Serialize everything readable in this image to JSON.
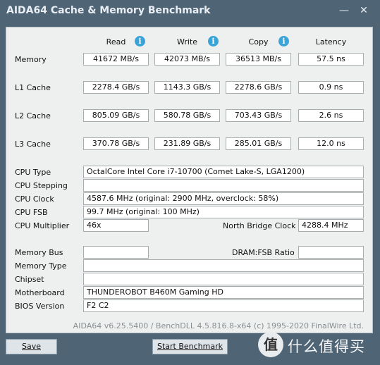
{
  "window": {
    "title": "AIDA64 Cache & Memory Benchmark"
  },
  "columns": {
    "read": "Read",
    "write": "Write",
    "copy": "Copy",
    "latency": "Latency"
  },
  "rows": [
    {
      "label": "Memory",
      "read": "41672 MB/s",
      "write": "42073 MB/s",
      "copy": "36513 MB/s",
      "latency": "57.5 ns"
    },
    {
      "label": "L1 Cache",
      "read": "2278.4 GB/s",
      "write": "1143.3 GB/s",
      "copy": "2278.6 GB/s",
      "latency": "0.9 ns"
    },
    {
      "label": "L2 Cache",
      "read": "805.09 GB/s",
      "write": "580.78 GB/s",
      "copy": "703.43 GB/s",
      "latency": "2.6 ns"
    },
    {
      "label": "L3 Cache",
      "read": "370.78 GB/s",
      "write": "231.89 GB/s",
      "copy": "285.01 GB/s",
      "latency": "12.0 ns"
    }
  ],
  "cpu": {
    "type_label": "CPU Type",
    "type": "OctalCore Intel Core i7-10700  (Comet Lake-S, LGA1200)",
    "stepping_label": "CPU Stepping",
    "stepping": "",
    "clock_label": "CPU Clock",
    "clock": "4587.6 MHz  (original: 2900 MHz, overclock: 58%)",
    "fsb_label": "CPU FSB",
    "fsb": "99.7 MHz  (original: 100 MHz)",
    "multiplier_label": "CPU Multiplier",
    "multiplier": "46x",
    "nb_clock_label": "North Bridge Clock",
    "nb_clock": "4288.4 MHz"
  },
  "mem": {
    "bus_label": "Memory Bus",
    "bus": "",
    "dram_ratio_label": "DRAM:FSB Ratio",
    "dram_ratio": "",
    "type_label": "Memory Type",
    "type": "",
    "chipset_label": "Chipset",
    "chipset": "",
    "motherboard_label": "Motherboard",
    "motherboard": "THUNDEROBOT B460M Gaming HD",
    "bios_label": "BIOS Version",
    "bios": "F2 C2"
  },
  "footer": "AIDA64 v6.25.5400 / BenchDLL 4.5.816.8-x64  (c) 1995-2020 FinalWire Ltd.",
  "buttons": {
    "save": "Save",
    "start": "Start Benchmark"
  },
  "watermark": {
    "glyph": "值",
    "text": "什么值得买"
  },
  "icons": {
    "info": "i",
    "minimize": "—",
    "close": "✕"
  }
}
